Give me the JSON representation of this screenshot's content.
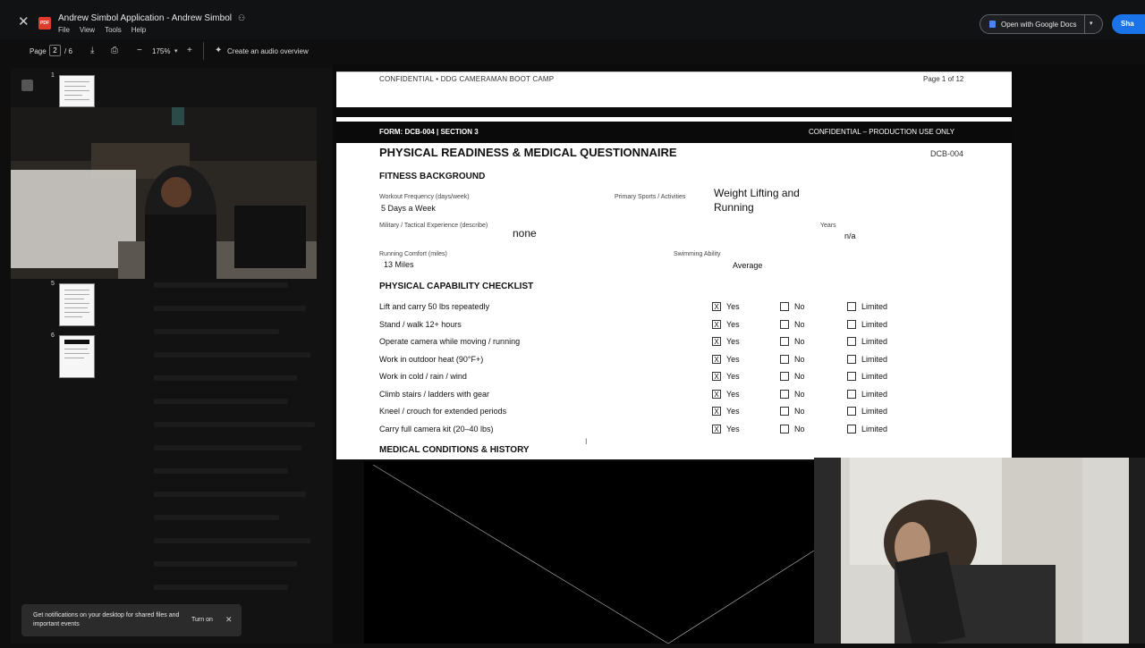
{
  "app": {
    "title": "Andrew Simbol Application - Andrew Simbol",
    "logo_text": "PDF",
    "menu": [
      "File",
      "View",
      "Tools",
      "Help"
    ],
    "open_with_label": "Open with Google Docs",
    "share_label": "Sha"
  },
  "toolbar": {
    "page_label": "Page",
    "current_page": "2",
    "page_total": "/ 6",
    "zoom": "175%",
    "audio_overview": "Create an audio overview"
  },
  "thumbnails": [
    {
      "num": "1"
    },
    {
      "num": "5"
    },
    {
      "num": "6"
    }
  ],
  "document": {
    "running_header": "CONFIDENTIAL • DDG CAMERAMAN BOOT CAMP",
    "page_of": "Page 1 of 12",
    "form_id": "FORM: DCB-004  |  SECTION 3",
    "confidential_prod": "CONFIDENTIAL – PRODUCTION USE ONLY",
    "title": "PHYSICAL READINESS & MEDICAL QUESTIONNAIRE",
    "form_code": "DCB-004",
    "fitness": {
      "heading": "FITNESS BACKGROUND",
      "workout_label": "Workout Frequency (days/week)",
      "workout_value": "5 Days a Week",
      "sports_label": "Primary Sports / Activities",
      "sports_value_1": "Weight Lifting and",
      "sports_value_2": "Running",
      "military_label": "Military / Tactical Experience (describe)",
      "military_value": "none",
      "years_label": "Years",
      "years_value": "n/a",
      "running_label": "Running Comfort (miles)",
      "running_value": "13 Miles",
      "swim_label": "Swimming Ability",
      "swim_value": "Average"
    },
    "checklist": {
      "heading": "PHYSICAL CAPABILITY CHECKLIST",
      "opt_yes": "Yes",
      "opt_no": "No",
      "opt_limited": "Limited",
      "check_mark": "X",
      "items": [
        "Lift and carry 50 lbs repeatedly",
        "Stand / walk 12+ hours",
        "Operate camera while moving / running",
        "Work in outdoor heat (90°F+)",
        "Work in cold / rain / wind",
        "Climb stairs / ladders with gear",
        "Kneel / crouch for extended periods",
        "Carry full camera kit (20–40 lbs)"
      ]
    },
    "medical": {
      "heading": "MEDICAL CONDITIONS & HISTORY"
    }
  },
  "toast": {
    "text": "Get notifications on your desktop for shared files and important events",
    "button": "Turn on"
  },
  "colors": {
    "pdf_red": "#e03b2c",
    "accent_blue": "#1a73e8"
  }
}
